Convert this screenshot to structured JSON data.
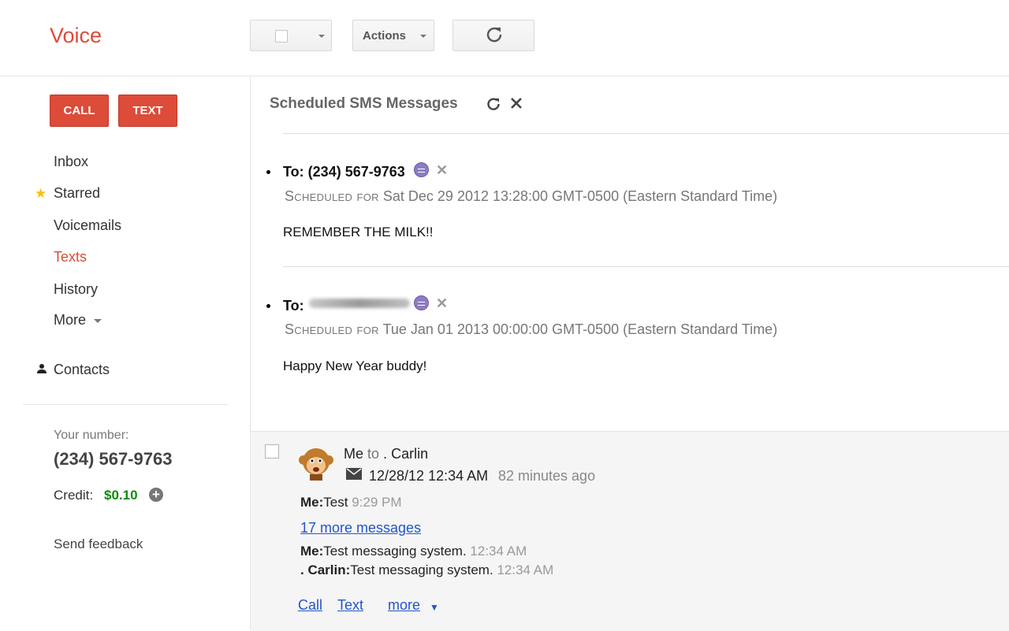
{
  "app": {
    "title": "Voice"
  },
  "toolbar": {
    "actions_label": "Actions"
  },
  "sidebar": {
    "call_label": "CALL",
    "text_label": "TEXT",
    "items": [
      {
        "label": "Inbox"
      },
      {
        "label": "Starred"
      },
      {
        "label": "Voicemails"
      },
      {
        "label": "Texts",
        "active": true
      },
      {
        "label": "History"
      },
      {
        "label": "More"
      }
    ],
    "contacts_label": "Contacts",
    "your_number_label": "Your number:",
    "your_number": "(234) 567-9763",
    "credit_label": "Credit:",
    "credit_value": "$0.10",
    "feedback_label": "Send feedback"
  },
  "scheduled": {
    "title": "Scheduled SMS Messages",
    "messages": [
      {
        "to_label": "To:",
        "to_number": "(234) 567-9763",
        "scheduled_label": "Scheduled for",
        "scheduled_time": "Sat Dec 29 2012 13:28:00 GMT-0500 (Eastern Standard Time)",
        "body": "REMEMBER THE MILK!!"
      },
      {
        "to_label": "To:",
        "to_number": "",
        "scheduled_label": "Scheduled for",
        "scheduled_time": "Tue Jan 01 2013 00:00:00 GMT-0500 (Eastern Standard Time)",
        "body": "Happy New Year buddy!"
      }
    ]
  },
  "conversation": {
    "from_me": "Me",
    "from_to": "to",
    "contact": ". Carlin",
    "time": "12/28/12 12:34 AM",
    "ago": "82 minutes ago",
    "more_messages": "17 more messages",
    "lines": [
      {
        "who": "Me:",
        "text": "Test",
        "ts": "9:29 PM"
      },
      {
        "who": "Me:",
        "text": "Test messaging system.",
        "ts": "12:34 AM"
      },
      {
        "who": ". Carlin:",
        "text": "Test messaging system.",
        "ts": "12:34 AM"
      }
    ],
    "actions": {
      "call": "Call",
      "text": "Text",
      "more": "more"
    }
  },
  "colors": {
    "brand": "#dd4b39",
    "credit": "#0b8b0b",
    "link": "#2255cc",
    "badge": "#8e7cc3"
  }
}
